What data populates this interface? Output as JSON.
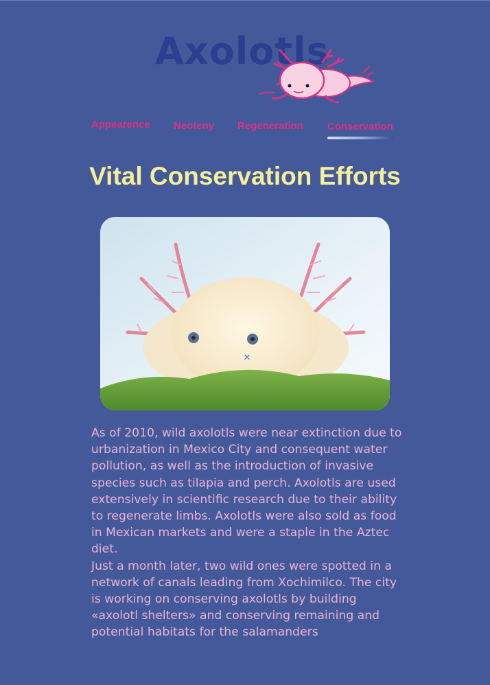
{
  "header": {
    "title": "Axolotls"
  },
  "nav": {
    "items": [
      {
        "label": "Appearence"
      },
      {
        "label": "Neoteny"
      },
      {
        "label": "Regeneration"
      },
      {
        "label": "Conservation"
      }
    ],
    "active": "Conservation"
  },
  "main": {
    "heading": "Vital Conservation Efforts",
    "paragraphs": [
      "As of 2010, wild axolotls were near extinction due to urbanization in Mexico City and consequent water pollution, as well as the introduction of invasive species such as tilapia and perch. Axolotls are used extensively in scientific research due to their ability to regenerate limbs. Axolotls were also sold as food in Mexican markets and were a staple in the Aztec diet.",
      "Just a month later, two wild ones were spotted in a network of canals leading from Xochimilco. The city is working on conserving axolotls by building «axolotl shelters» and conserving remaining and potential habitats for the salamanders"
    ]
  },
  "colors": {
    "background": "#44599a",
    "title": "#2c3e8e",
    "nav_link": "#d63384",
    "heading": "#f6ef9a",
    "body_text": "#eab3d8"
  },
  "icons": {
    "logo": "axolotl-logo-icon",
    "cursor": "crosshair-cursor-icon"
  }
}
